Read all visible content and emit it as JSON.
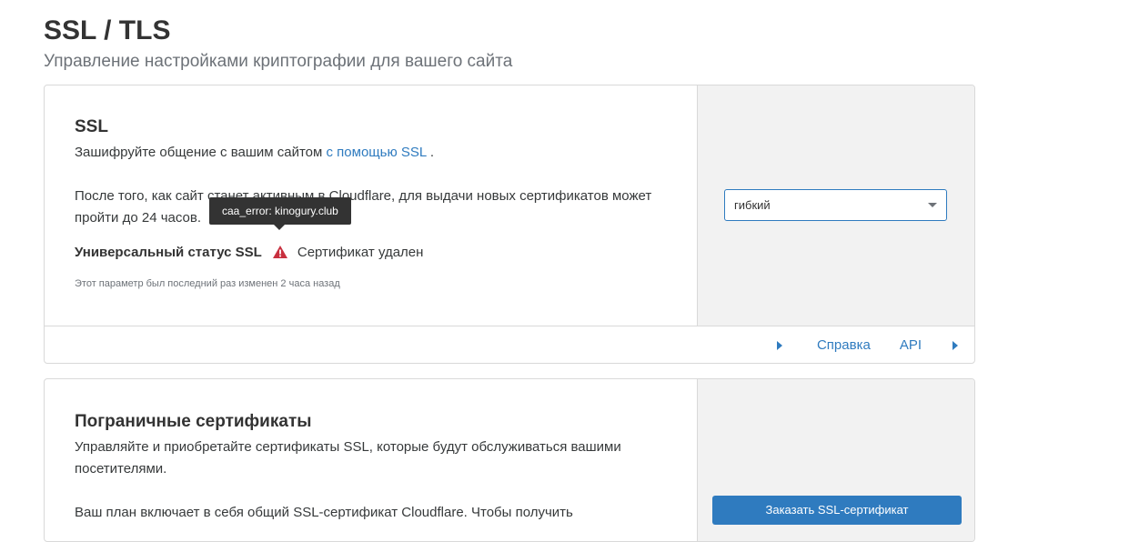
{
  "page": {
    "title": "SSL / TLS",
    "subtitle": "Управление настройками криптографии для вашего сайта"
  },
  "ssl_card": {
    "title": "SSL",
    "intro_text": "Зашифруйте общение с вашим сайтом ",
    "intro_link": "с помощью SSL",
    "intro_end": " .",
    "info_text": "После того, как сайт станет активным в Cloudflare, для выдачи новых сертификатов может пройти до 24 часов.",
    "status_label": "Универсальный статус SSL",
    "status_value": "Сертификат удален",
    "tooltip": "caa_error: kinogury.club",
    "changed_note": "Этот параметр был последний раз изменен 2 часа назад",
    "mode_select": {
      "selected": "гибкий"
    },
    "footer": {
      "help_label": "Справка",
      "api_label": "API"
    }
  },
  "edge_card": {
    "title": "Пограничные сертификаты",
    "description": "Управляйте и приобретайте сертификаты SSL, которые будут обслуживаться вашими посетителями.",
    "plan_text": "Ваш план включает в себя общий SSL-сертификат Cloudflare. Чтобы получить",
    "order_button": "Заказать SSL-сертификат"
  },
  "colors": {
    "accent": "#2f7bbf",
    "warning": "#c8303f",
    "tooltip_bg": "#333333",
    "side_panel_bg": "#f2f2f2"
  },
  "icons": {
    "status_warning": "warning-triangle-icon",
    "select_caret": "caret-down-icon",
    "footer_arrows": "caret-right-icon"
  }
}
